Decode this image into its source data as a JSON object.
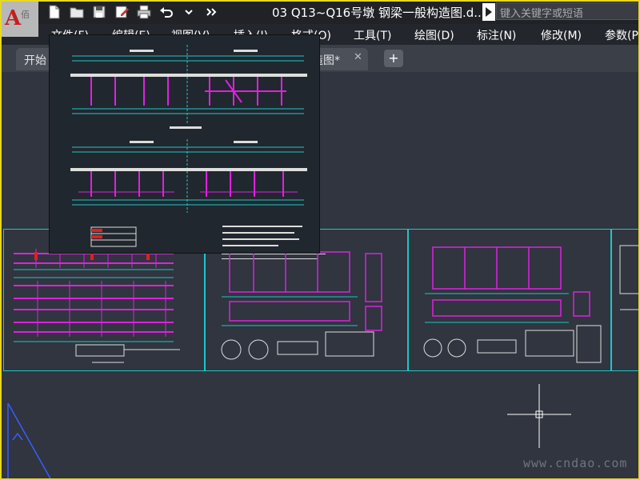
{
  "app": {
    "logo_letter": "A",
    "logo_watermark": "佰"
  },
  "document": {
    "title": "03 Q13~Q16号墩 钢梁一般构造图.d..."
  },
  "search": {
    "placeholder": "键入关键字或短语"
  },
  "menu": [
    {
      "label": "文件(F)"
    },
    {
      "label": "编辑(E)"
    },
    {
      "label": "视图(V)"
    },
    {
      "label": "插入(I)"
    },
    {
      "label": "格式(O)"
    },
    {
      "label": "工具(T)"
    },
    {
      "label": "绘图(D)"
    },
    {
      "label": "标注(N)"
    },
    {
      "label": "修改(M)"
    },
    {
      "label": "参数(P"
    }
  ],
  "tabs": [
    {
      "label": "开始"
    },
    {
      "label": "造图*"
    }
  ],
  "icons": {
    "new": "new-file-icon",
    "open": "open-folder-icon",
    "save": "save-icon",
    "saveas": "save-as-icon",
    "print": "print-icon",
    "undo": "undo-icon",
    "more": "overflow-icon",
    "close": "close-icon",
    "add": "plus-icon"
  },
  "watermark": "www.cndao.com",
  "colors": {
    "accent": "#e8d820",
    "drawing_magenta": "#e020e0",
    "drawing_cyan": "#1ec7c7",
    "background": "#30353f"
  }
}
